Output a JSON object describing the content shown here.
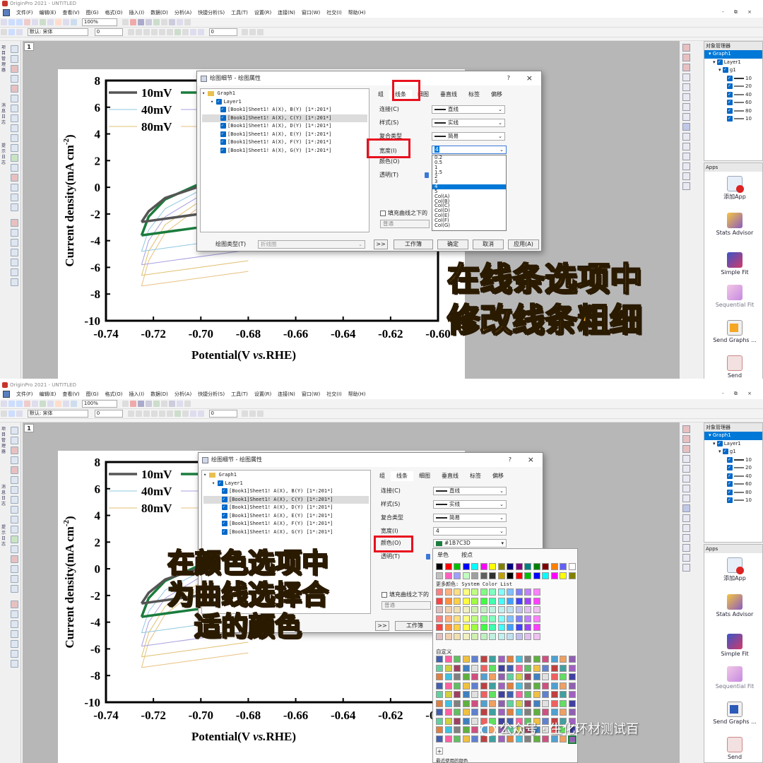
{
  "app": {
    "title": "OriginPro 2021 - UNTITLED"
  },
  "menu": [
    "文件(F)",
    "编辑(E)",
    "查看(V)",
    "图(G)",
    "格式(O)",
    "插入(I)",
    "数据(D)",
    "分析(A)",
    "快捷分析(S)",
    "工具(T)",
    "设置(R)",
    "连接(N)",
    "窗口(W)",
    "社交(I)",
    "帮助(H)"
  ],
  "window_controls": "- ⧉ ×",
  "toolbar": {
    "zoom": "100%",
    "font": "默认: 宋体",
    "size_field": "0",
    "size_field2": "0"
  },
  "graph_tab": "1",
  "plot": {
    "ylabel": "Current density(mA cm",
    "ylabel_sup": "-2",
    "ylabel_close": ")",
    "xlabel_pre": "Potential(V ",
    "xlabel_vs": "vs.",
    "xlabel_post": "RHE)",
    "yticks": [
      "8",
      "6",
      "4",
      "2",
      "0",
      "-2",
      "-4",
      "-6",
      "-8",
      "-10"
    ],
    "xticks": [
      "-0.74",
      "-0.72",
      "-0.70",
      "-0.68",
      "-0.66",
      "-0.64",
      "-0.62",
      "-0.60"
    ],
    "legend": [
      "10mV",
      "40mV",
      "80mV"
    ]
  },
  "chart_data": {
    "type": "line",
    "xlabel": "Potential(V vs.RHE)",
    "ylabel": "Current density(mA cm-2)",
    "xlim": [
      -0.74,
      -0.6
    ],
    "ylim": [
      -10,
      8
    ],
    "series": [
      {
        "name": "10mV",
        "color": "#555555",
        "x": [
          -0.725,
          -0.722,
          -0.715,
          -0.7,
          -0.69,
          -0.68
        ],
        "y": [
          -2.6,
          -1.8,
          -0.8,
          0.1,
          0.5,
          0.6
        ]
      },
      {
        "name": "20mV",
        "color": "#1B7C3D",
        "x": [
          -0.725,
          -0.722,
          -0.715,
          -0.7,
          -0.69,
          -0.68
        ],
        "y": [
          -3.6,
          -2.2,
          -0.9,
          0.3,
          0.7,
          0.8
        ]
      },
      {
        "name": "40mV",
        "color": "#8fc8e0",
        "x": [
          -0.725,
          -0.722,
          -0.715,
          -0.7,
          -0.69,
          -0.68
        ],
        "y": [
          -4.8,
          -3.2,
          -1.6,
          -0.2,
          0.3,
          0.5
        ]
      },
      {
        "name": "60mV",
        "color": "#a8a0e0",
        "x": [
          -0.725,
          -0.722,
          -0.715,
          -0.7,
          -0.69,
          -0.68
        ],
        "y": [
          -5.8,
          -4.0,
          -2.2,
          -0.6,
          0.1,
          0.3
        ]
      },
      {
        "name": "80mV",
        "color": "#e0c070",
        "x": [
          -0.725,
          -0.722,
          -0.715,
          -0.7,
          -0.69,
          -0.68
        ],
        "y": [
          -6.6,
          -4.8,
          -2.8,
          -1.0,
          -0.2,
          0.1
        ]
      },
      {
        "name": "100mV",
        "color": "#e8c080",
        "x": [
          -0.725,
          -0.722,
          -0.715,
          -0.7,
          -0.69,
          -0.68
        ],
        "y": [
          -7.4,
          -5.5,
          -3.4,
          -1.4,
          -0.5,
          -0.1
        ]
      }
    ]
  },
  "object_manager": {
    "title": "对象管理器",
    "graph": "Graph1",
    "layer": "Layer1",
    "group": "g1",
    "plots": [
      "10",
      "20",
      "40",
      "60",
      "80",
      "10"
    ]
  },
  "apps": {
    "title": "Apps",
    "items": [
      "添加App",
      "Stats Advisor",
      "Simple Fit",
      "Sequential Fit",
      "Send Graphs ...",
      "Send"
    ]
  },
  "dialog": {
    "title": "绘图细节 - 绘图属性",
    "help": "?",
    "close": "×",
    "tree_graph": "Graph1",
    "tree_layer": "Layer1",
    "tree_items": [
      "[Book1]Sheet1! A(X), B(Y) [1*:201*]",
      "[Book1]Sheet1! A(X), C(Y) [1*:201*]",
      "[Book1]Sheet1! A(X), D(Y) [1*:201*]",
      "[Book1]Sheet1! A(X), E(Y) [1*:201*]",
      "[Book1]Sheet1! A(X), F(Y) [1*:201*]",
      "[Book1]Sheet1! A(X), G(Y) [1*:201*]"
    ],
    "tabs": [
      "组",
      "线条",
      "细图",
      "垂直线",
      "标签",
      "偏移"
    ],
    "rows": {
      "connect": "连接(C)",
      "style": "样式(S)",
      "compound": "复合类型",
      "width": "宽度(I)",
      "color": "颜色(O)",
      "transparency": "透明(T)"
    },
    "values": {
      "connect": "直线",
      "style": "实线",
      "compound": "简易",
      "width": "4",
      "color": "#1B7C3D"
    },
    "fill_under": "填充曲线之下的",
    "normal": "普通",
    "plot_type_label": "绘图类型(T)",
    "plot_type_value": "折线图",
    "expand": ">>",
    "workbook": "工作簿",
    "ok": "确定",
    "cancel": "取消",
    "apply": "应用(A)"
  },
  "width_options": [
    "0.2",
    "0.5",
    "1",
    "1.5",
    "2",
    "3",
    "4",
    "5",
    "Col(A)",
    "Col(B)",
    "Col(C)",
    "Col(D)",
    "Col(E)",
    "Col(F)",
    "Col(G)"
  ],
  "width_selected": "4",
  "color_picker": {
    "tabs": [
      "单色",
      "按点"
    ],
    "more": "更多颜色: System Color List",
    "custom": "自定义",
    "plus": "+",
    "recent": "最近使用的颜色"
  },
  "captions": {
    "top_line1": "在线条选项中",
    "top_line2": "修改线条粗细",
    "bottom_line1": "在颜色选项中",
    "bottom_line2": "为曲线选择合",
    "bottom_line3": "适的颜色"
  },
  "watermark": "公众号 · 生化环材测试百"
}
